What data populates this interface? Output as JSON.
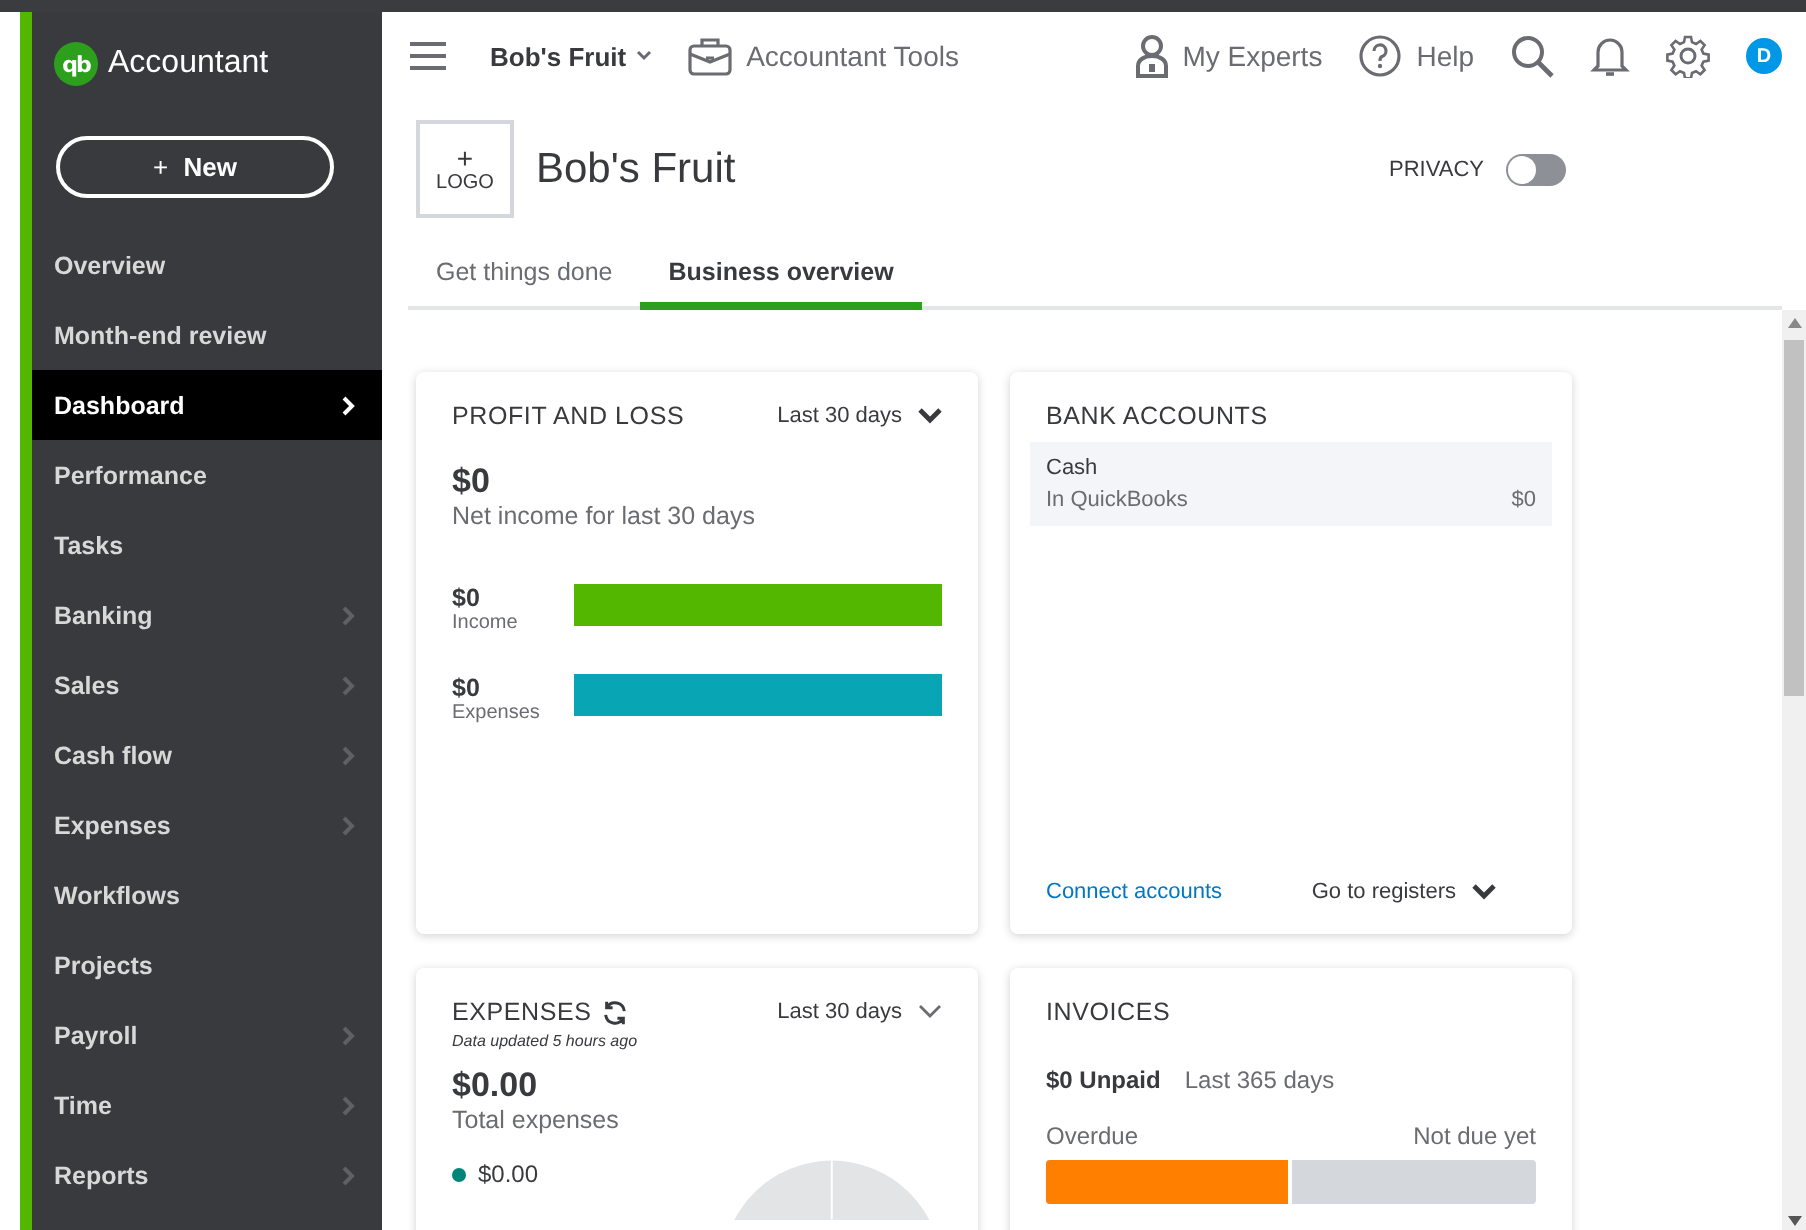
{
  "brand": {
    "logo": "qb",
    "name": "Accountant"
  },
  "new_button": {
    "plus": "+",
    "label": "New"
  },
  "sidebar": {
    "items": [
      {
        "label": "Overview",
        "selected": false,
        "has_submenu": false
      },
      {
        "label": "Month-end review",
        "selected": false,
        "has_submenu": false
      },
      {
        "label": "Dashboard",
        "selected": true,
        "has_submenu": true
      },
      {
        "label": "Performance",
        "selected": false,
        "has_submenu": false
      },
      {
        "label": "Tasks",
        "selected": false,
        "has_submenu": false
      },
      {
        "label": "Banking",
        "selected": false,
        "has_submenu": true
      },
      {
        "label": "Sales",
        "selected": false,
        "has_submenu": true
      },
      {
        "label": "Cash flow",
        "selected": false,
        "has_submenu": true
      },
      {
        "label": "Expenses",
        "selected": false,
        "has_submenu": true
      },
      {
        "label": "Workflows",
        "selected": false,
        "has_submenu": false
      },
      {
        "label": "Projects",
        "selected": false,
        "has_submenu": false
      },
      {
        "label": "Payroll",
        "selected": false,
        "has_submenu": true
      },
      {
        "label": "Time",
        "selected": false,
        "has_submenu": true
      },
      {
        "label": "Reports",
        "selected": false,
        "has_submenu": true
      }
    ]
  },
  "topbar": {
    "company": "Bob's Fruit",
    "accountant_tools": "Accountant Tools",
    "my_experts": "My Experts",
    "help": "Help",
    "avatar": "D"
  },
  "company": {
    "logo_plus": "+",
    "logo_label": "LOGO",
    "name": "Bob's Fruit",
    "privacy_label": "PRIVACY",
    "privacy_on": false
  },
  "tabs": [
    {
      "label": "Get things done",
      "selected": false
    },
    {
      "label": "Business overview",
      "selected": true
    }
  ],
  "profit_and_loss": {
    "title": "PROFIT AND LOSS",
    "period": "Last 30 days",
    "amount": "$0",
    "caption": "Net income for last 30 days",
    "rows": [
      {
        "amount": "$0",
        "label": "Income",
        "color": "#53b700"
      },
      {
        "amount": "$0",
        "label": "Expenses",
        "color": "#08a5b5"
      }
    ]
  },
  "bank_accounts": {
    "title": "BANK ACCOUNTS",
    "accounts": [
      {
        "name": "Cash",
        "source": "In QuickBooks",
        "balance": "$0"
      }
    ],
    "connect_link": "Connect accounts",
    "registers": "Go to registers"
  },
  "expenses": {
    "title": "EXPENSES",
    "updated": "Data updated 5 hours ago",
    "period": "Last 30 days",
    "amount": "$0.00",
    "caption": "Total expenses",
    "legend": [
      {
        "amount": "$0.00",
        "color": "#00857b"
      }
    ]
  },
  "invoices": {
    "title": "INVOICES",
    "unpaid": "$0 Unpaid",
    "period": "Last 365 days",
    "overdue_label": "Overdue",
    "not_due_label": "Not due yet",
    "level": 0.5
  }
}
